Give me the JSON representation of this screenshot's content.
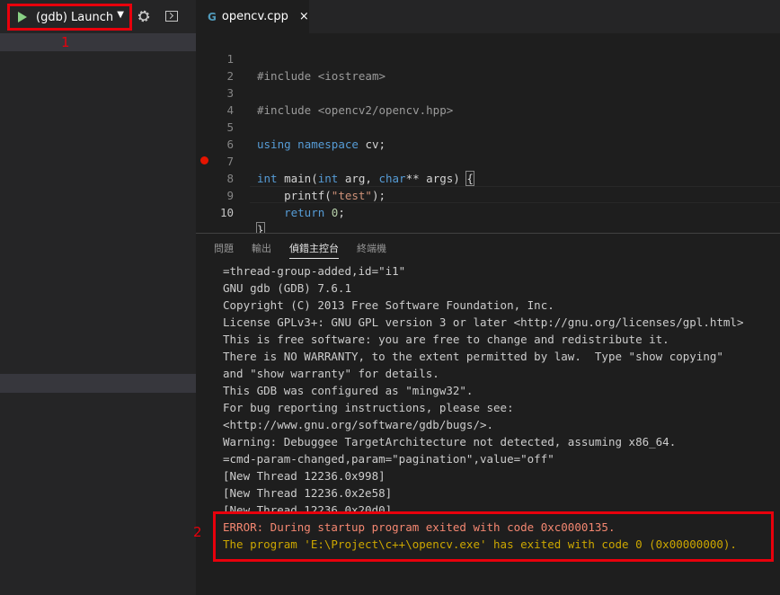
{
  "debug": {
    "config_name": "(gdb) Launch",
    "caret": "▼",
    "marker_1": "1",
    "marker_2": "2"
  },
  "editor": {
    "tab_icon": "G",
    "tab_name": "opencv.cpp",
    "tab_close": "×",
    "line_numbers": [
      "1",
      "2",
      "3",
      "4",
      "5",
      "6",
      "7",
      "8",
      "9",
      "10"
    ],
    "code": {
      "l1_directive": "#include",
      "l1_arg": " <iostream>",
      "l3_directive": "#include",
      "l3_arg": " <opencv2/opencv.hpp>",
      "l5_using": "using",
      "l5_namespace": "namespace",
      "l5_name": "cv;",
      "l7_int": "int",
      "l7_main": "main",
      "l7_open": "(",
      "l7_int2": "int",
      "l7_arg": " arg, ",
      "l7_char": "char",
      "l7_rest": "** args) ",
      "l7_brace": "{",
      "l8_indent": "    ",
      "l8_fn": "printf",
      "l8_open": "(",
      "l8_str": "\"test\"",
      "l8_close": ");",
      "l9_indent": "    ",
      "l9_return": "return",
      "l9_space": " ",
      "l9_num": "0",
      "l9_semi": ";",
      "l10_brace": "}"
    }
  },
  "panel": {
    "tabs": [
      "問題",
      "輸出",
      "偵錯主控台",
      "終端機"
    ],
    "console_lines": [
      "=thread-group-added,id=\"i1\"",
      "GNU gdb (GDB) 7.6.1",
      "Copyright (C) 2013 Free Software Foundation, Inc.",
      "License GPLv3+: GNU GPL version 3 or later <http://gnu.org/licenses/gpl.html>",
      "This is free software: you are free to change and redistribute it.",
      "There is NO WARRANTY, to the extent permitted by law.  Type \"show copying\"",
      "and \"show warranty\" for details.",
      "This GDB was configured as \"mingw32\".",
      "For bug reporting instructions, please see:",
      "<http://www.gnu.org/software/gdb/bugs/>.",
      "Warning: Debuggee TargetArchitecture not detected, assuming x86_64.",
      "=cmd-param-changed,param=\"pagination\",value=\"off\"",
      "[New Thread 12236.0x998]",
      "[New Thread 12236.0x2e58]",
      "[New Thread 12236.0x20d0]"
    ],
    "error_lines": [
      "ERROR: During startup program exited with code 0xc0000135.",
      "The program 'E:\\Project\\c++\\opencv.exe' has exited with code 0 (0x00000000)."
    ]
  },
  "colors": {
    "error_red": "#f48771",
    "exit_orange": "#cca700",
    "highlight_red": "#e8000c",
    "play_green": "#89d185"
  }
}
